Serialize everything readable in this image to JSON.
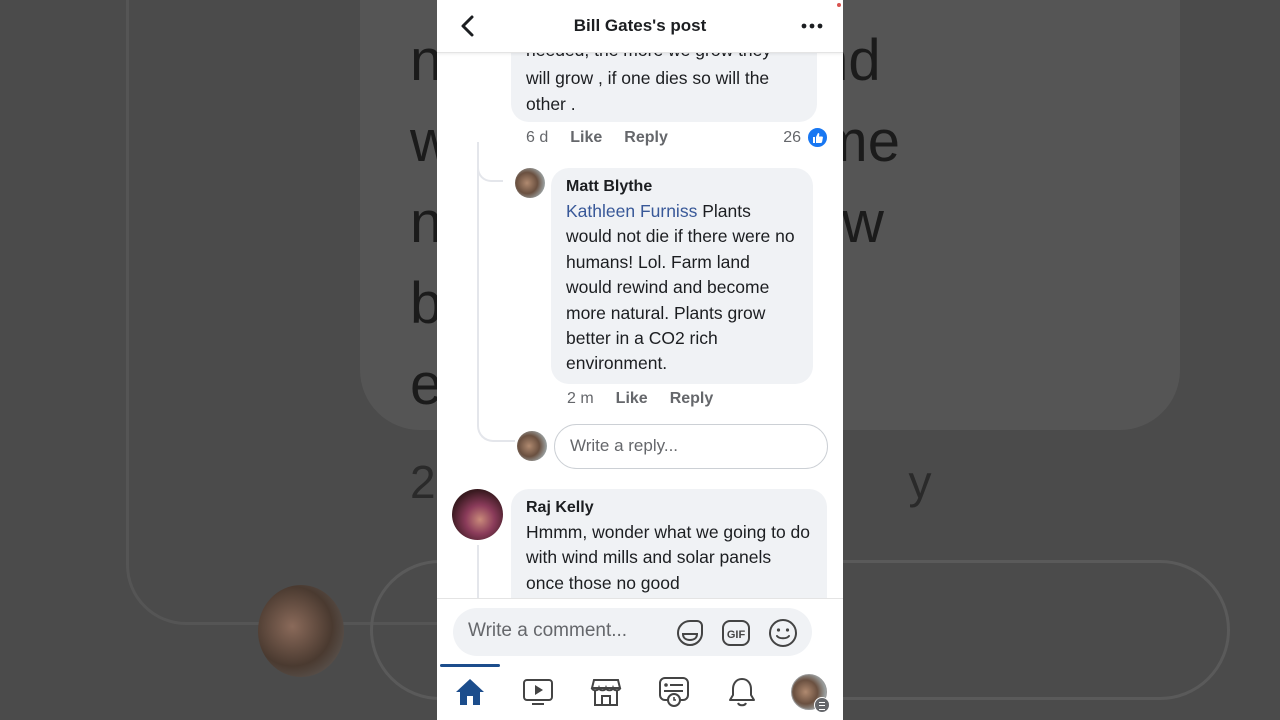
{
  "header": {
    "title": "Bill Gates's post",
    "back_icon": "chevron-left-icon",
    "more_icon": "more-horizontal-icon",
    "more_label": "•••"
  },
  "comments": [
    {
      "text_partial_top": "needed, the more we grow they",
      "text": "will grow , if one dies so will the other .",
      "text_lines": [
        "will grow , if one dies so will the",
        "other ."
      ],
      "time": "6 d",
      "like_label": "Like",
      "reply_label": "Reply",
      "reaction_count": "26",
      "reaction_icon": "like-reaction-icon"
    },
    {
      "author": "Matt Blythe",
      "mention": "Kathleen Furniss",
      "text": " Plants would not die if there were no humans! Lol. Farm land would rewind and become more natural. Plants grow better in a CO2 rich environment.",
      "time": "2 m",
      "like_label": "Like",
      "reply_label": "Reply"
    },
    {
      "author": "Raj Kelly",
      "text": "Hmmm, wonder what we going to do with wind mills and solar panels once those no good"
    }
  ],
  "reply_input": {
    "placeholder": "Write a reply..."
  },
  "composer": {
    "placeholder": "Write a comment...",
    "icons": [
      "sticker-icon",
      "gif-icon",
      "emoji-icon"
    ],
    "gif_label": "GIF"
  },
  "tabbar": {
    "tabs": [
      {
        "name": "home",
        "icon": "home-icon",
        "active": true
      },
      {
        "name": "watch",
        "icon": "video-icon"
      },
      {
        "name": "marketplace",
        "icon": "store-icon"
      },
      {
        "name": "news",
        "icon": "news-clock-icon"
      },
      {
        "name": "notifications",
        "icon": "bell-icon"
      },
      {
        "name": "menu",
        "icon": "profile-menu-icon"
      }
    ]
  },
  "background": {
    "text_lines": [
      "n           Farm land",
      "w          nd become",
      "n           lants grow",
      "b           rich",
      "e"
    ],
    "text_line2": "2                                     y"
  },
  "colors": {
    "accent": "#1877f2",
    "mention": "#385898",
    "active_tab": "#1c4d8c",
    "bubble": "#f0f2f5",
    "secondary_text": "#65676b"
  }
}
